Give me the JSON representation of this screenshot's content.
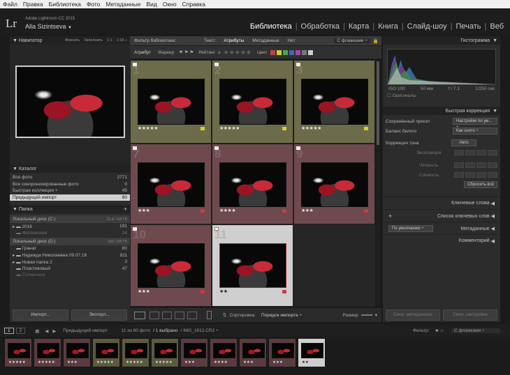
{
  "menu": [
    "Файл",
    "Правка",
    "Библиотека",
    "Фото",
    "Метаданные",
    "Вид",
    "Окно",
    "Справка"
  ],
  "identity": {
    "logo": "Lr",
    "product": "Adobe Lightroom CC 2015",
    "user": "Alla Sizintseva",
    "user_caret": "▼"
  },
  "modules": {
    "items": [
      "Библиотека",
      "Обработка",
      "Карта",
      "Книга",
      "Слайд-шоу",
      "Печать",
      "Веб"
    ],
    "active": "Библиотека"
  },
  "navigator": {
    "title": "Навигатор",
    "fit": "Вписать",
    "fill": "Заполнить",
    "one": "1:1",
    "ratio": "1:16 ÷"
  },
  "catalog": {
    "title": "Каталог",
    "rows": [
      {
        "label": "Все фото",
        "count": "2771"
      },
      {
        "label": "Все синхронизированные фото",
        "count": "0"
      },
      {
        "label": "Быстрая коллекция +",
        "count": "45"
      },
      {
        "label": "Предыдущий импорт",
        "count": "80"
      }
    ]
  },
  "folders": {
    "title": "Папка",
    "add": "+",
    "volumes": [
      {
        "name": "Локальный диск (C:)",
        "info": "21,4 / 116 ГБ",
        "items": [
          {
            "label": "2016",
            "count": "191"
          },
          {
            "label": "Фотосессия",
            "count": "24"
          }
        ]
      },
      {
        "name": "Локальный диск (D:)",
        "info": "136 / 235 ГБ",
        "items": [
          {
            "label": "Гранат",
            "count": "80"
          },
          {
            "label": "Надежда Николаевна 09.07.16",
            "count": "911"
          },
          {
            "label": "Новая папка 2",
            "count": "3"
          },
          {
            "label": "Пластиковый",
            "count": "47"
          },
          {
            "label": "Солнечное",
            "count": ""
          }
        ]
      }
    ]
  },
  "left_buttons": {
    "import": "Импорт...",
    "export": "Экспорт..."
  },
  "filter_bar": {
    "title": "Фильтр библиотеки:",
    "tabs": [
      "Текст",
      "Атрибуты",
      "Метаданные",
      "Нет"
    ],
    "active": "Атрибуты",
    "preset": "С флажками ÷"
  },
  "attr_bar": {
    "attr": "Атрибут",
    "flag": "Маркер",
    "rating": "Рейтинг",
    "rating_op": "≥",
    "stars": "★★★★★",
    "color": "Цвет"
  },
  "grid": {
    "cells": [
      {
        "num": "1",
        "stars": "★★★★★",
        "label": "yellow"
      },
      {
        "num": "2",
        "stars": "★★★★★",
        "label": "yellow"
      },
      {
        "num": "3",
        "stars": "★★★★★",
        "label": "yellow"
      },
      {
        "num": "7",
        "stars": "★★★",
        "label": "red"
      },
      {
        "num": "8",
        "stars": "★★★★",
        "label": "red"
      },
      {
        "num": "9",
        "stars": "★★★",
        "label": "red"
      },
      {
        "num": "10",
        "stars": "★★★",
        "label": "red"
      },
      {
        "num": "11",
        "stars": "★★",
        "label": "red"
      }
    ]
  },
  "bottom_toolbar": {
    "sort_label": "Сортировка:",
    "sort_value": "Порядок импорта ÷",
    "size_label": "Размер"
  },
  "histogram": {
    "title": "Гистограмма",
    "iso": "ISO 100",
    "focal": "50 мм",
    "aperture": "f / 7,1",
    "shutter": "1/250 сек",
    "originals": "Оригиналы"
  },
  "quick_develop": {
    "title": "Быстрая коррекция",
    "saved_preset": "Сохранённый пресет",
    "saved_preset_value": "Настройки по ум... ÷",
    "wb": "Баланс белого",
    "wb_value": "Как снято ÷",
    "tone": "Коррекция тона",
    "auto": "Авто",
    "exposure": "Экспозиция",
    "clarity": "Чёткость",
    "vibrance": "Сочность",
    "reset": "Сбросить всё"
  },
  "keywording": {
    "title": "Ключевые слова",
    "list_title": "Список ключевых слов",
    "add": "+"
  },
  "metadata": {
    "title": "Метаданные",
    "preset": "По умолчанию ÷"
  },
  "comments": {
    "title": "Комментарий"
  },
  "right_buttons": {
    "sync_meta": "Синх. метаданные",
    "sync_settings": "Синх. настройки"
  },
  "filmstrip_bar": {
    "page1": "1",
    "page2": "2",
    "source": "Предыдущий импорт",
    "count": "11 из 80 фото",
    "selected": "/ 1 выбрано",
    "file": "/ IMG_1612.CR2 ÷",
    "filter_label": "Фильтр:",
    "filter_value": "С флажками ÷"
  },
  "filmstrip": {
    "thumbs": [
      {
        "stars": "★★★★★",
        "bg": "#5a3c40"
      },
      {
        "stars": "★★★★★",
        "bg": "#5a3c40"
      },
      {
        "stars": "★★★",
        "bg": "#5a3c40"
      },
      {
        "stars": "★★★★★",
        "bg": "#5c5a3e"
      },
      {
        "stars": "★★★★★",
        "bg": "#5c5a3e"
      },
      {
        "stars": "★★★★★",
        "bg": "#5c5a3e"
      },
      {
        "stars": "★★★",
        "bg": "#5a3c40"
      },
      {
        "stars": "★★★★",
        "bg": "#5a3c40"
      },
      {
        "stars": "★★★",
        "bg": "#5a3c40"
      },
      {
        "stars": "★★★",
        "bg": "#5a3c40"
      },
      {
        "stars": "★★",
        "bg": "#cfcfcf"
      }
    ]
  }
}
